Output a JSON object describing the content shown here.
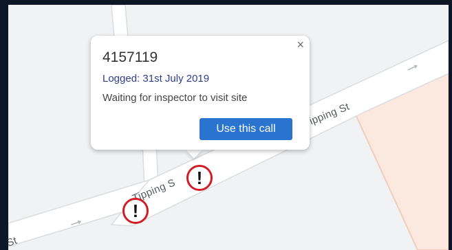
{
  "map": {
    "streets": [
      {
        "id": "tipping-st-upper",
        "label": "Tipping St"
      },
      {
        "id": "tipping-st-lower",
        "label": "Tipping S"
      },
      {
        "id": "st-left",
        "label": "St"
      }
    ],
    "colors": {
      "background": "#f1f2f4",
      "road": "#ffffff",
      "road_edge": "#d9dce0",
      "building": "#fbe8df",
      "building_edge": "#f1cdbd",
      "marker_ring": "#d11c24",
      "arrow": "#b4b8bd"
    },
    "markers": [
      {
        "id": "marker-1",
        "symbol": "!"
      },
      {
        "id": "marker-2",
        "symbol": "!"
      }
    ]
  },
  "popup": {
    "call_id": "4157119",
    "logged": "Logged: 31st July 2019",
    "status": "Waiting for inspector to visit site",
    "button_label": "Use this call",
    "close_symbol": "×",
    "colors": {
      "button": "#2a74cf",
      "logged_text": "#2e3e8c"
    }
  }
}
